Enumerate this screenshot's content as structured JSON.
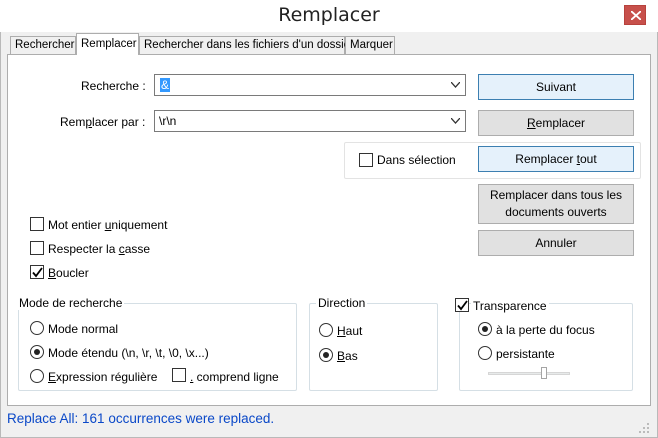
{
  "window": {
    "title": "Remplacer",
    "close_icon": "close-x-icon"
  },
  "tabs": [
    {
      "label": "Rechercher",
      "active": false
    },
    {
      "label": "Remplacer",
      "active": true
    },
    {
      "label": "Rechercher dans les fichiers d'un dossier",
      "active": false
    },
    {
      "label": "Marquer",
      "active": false
    }
  ],
  "search": {
    "label": "Recherche :",
    "value": "&",
    "dropdown_icon": "chevron-down-icon"
  },
  "replace": {
    "label": "Remplacer par :",
    "value": "\\r\\n",
    "dropdown_icon": "chevron-down-icon"
  },
  "buttons": {
    "next": "Suivant",
    "replace": "Remplacer",
    "replace_all": "Remplacer tout",
    "replace_all_docs_line1": "Remplacer dans tous les",
    "replace_all_docs_line2": "documents ouverts",
    "cancel": "Annuler"
  },
  "in_selection": {
    "label": "Dans sélection",
    "checked": false
  },
  "options": {
    "whole_word": {
      "label": "Mot entier uniquement",
      "checked": false
    },
    "match_case": {
      "label": "Respecter la casse",
      "checked": false
    },
    "wrap": {
      "label": "Boucler",
      "checked": true
    }
  },
  "search_mode": {
    "title": "Mode de recherche",
    "normal": {
      "label": "Mode normal",
      "selected": false
    },
    "extended": {
      "label": "Mode étendu (\\n, \\r, \\t, \\0, \\x...)",
      "selected": true
    },
    "regex": {
      "label": "Expression régulière",
      "selected": false
    },
    "dot_newline": {
      "label": ". comprend ligne",
      "checked": false
    }
  },
  "direction": {
    "title": "Direction",
    "up": {
      "label": "Haut",
      "selected": false
    },
    "down": {
      "label": "Bas",
      "selected": true
    }
  },
  "transparency": {
    "title": "Transparence",
    "checked": true,
    "on_focus_lost": {
      "label": "à la perte du focus",
      "selected": true
    },
    "always": {
      "label": "persistante",
      "selected": false
    },
    "level": 0.7
  },
  "status": {
    "text": "Replace All: 161 occurrences were replaced.",
    "color": "#0a48c8"
  }
}
